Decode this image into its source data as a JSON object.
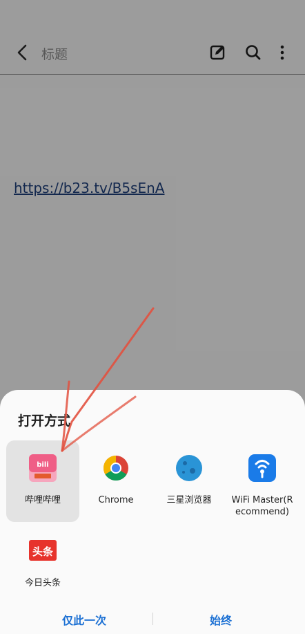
{
  "app_bar": {
    "title": "标题",
    "back_icon": "back-chevron-icon",
    "edit_icon": "edit-icon",
    "search_icon": "search-icon",
    "more_icon": "more-vertical-icon"
  },
  "note": {
    "link_text": "https://b23.tv/B5sEnA"
  },
  "chooser": {
    "title": "打开方式",
    "apps": [
      {
        "label": "哔哩哔哩",
        "icon": "bilibili-icon",
        "selected": true
      },
      {
        "label": "Chrome",
        "icon": "chrome-icon",
        "selected": false
      },
      {
        "label": "三星浏览器",
        "icon": "samsung-internet-icon",
        "selected": false
      },
      {
        "label": "WiFi Master(Recommend)",
        "label_lines": [
          "WiFi Master(R",
          "ecommend)"
        ],
        "icon": "wifi-master-icon",
        "selected": false
      },
      {
        "label": "今日头条",
        "icon": "toutiao-icon",
        "selected": false
      }
    ],
    "actions": {
      "just_once": "仅此一次",
      "always": "始终"
    }
  },
  "colors": {
    "accent": "#1a6fd3",
    "dim_overlay": "#5a5a5a",
    "annotation": "#e2513f",
    "link": "#1f3f7a"
  }
}
